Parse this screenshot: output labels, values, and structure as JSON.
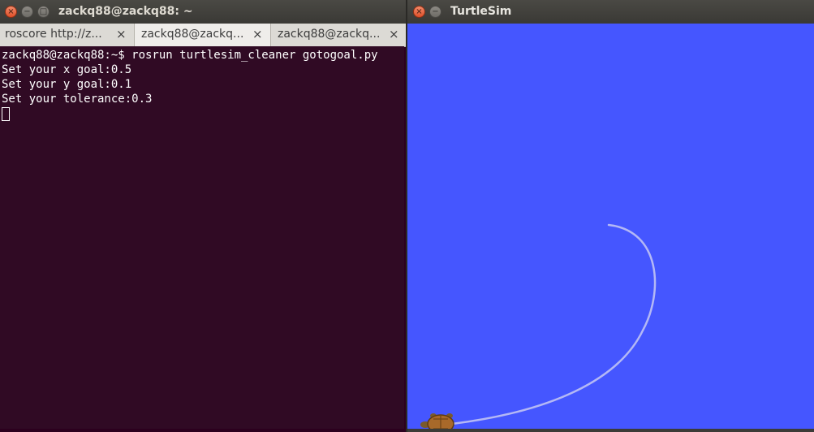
{
  "terminal_window": {
    "title": "zackq88@zackq88: ~",
    "close_glyph": "×",
    "minimize_glyph": "−",
    "maximize_glyph": "□",
    "tabs": [
      {
        "label": "roscore http://z...",
        "close_glyph": "×"
      },
      {
        "label": "zackq88@zackq...",
        "close_glyph": "×"
      },
      {
        "label": "zackq88@zackq...",
        "close_glyph": "×"
      }
    ],
    "lines": [
      "zackq88@zackq88:~$ rosrun turtlesim_cleaner gotogoal.py",
      "Set your x goal:0.5",
      "Set your y goal:0.1",
      "Set your tolerance:0.3"
    ],
    "colors": {
      "background": "#300a24",
      "text": "#ffffff"
    }
  },
  "turtlesim_window": {
    "title": "TurtleSim",
    "close_glyph": "×",
    "minimize_glyph": "−",
    "colors": {
      "background": "#4556ff",
      "pen": "#b4b8f5",
      "turtle_shell": "#a8692a"
    },
    "turtle_icon": "turtle-icon"
  }
}
